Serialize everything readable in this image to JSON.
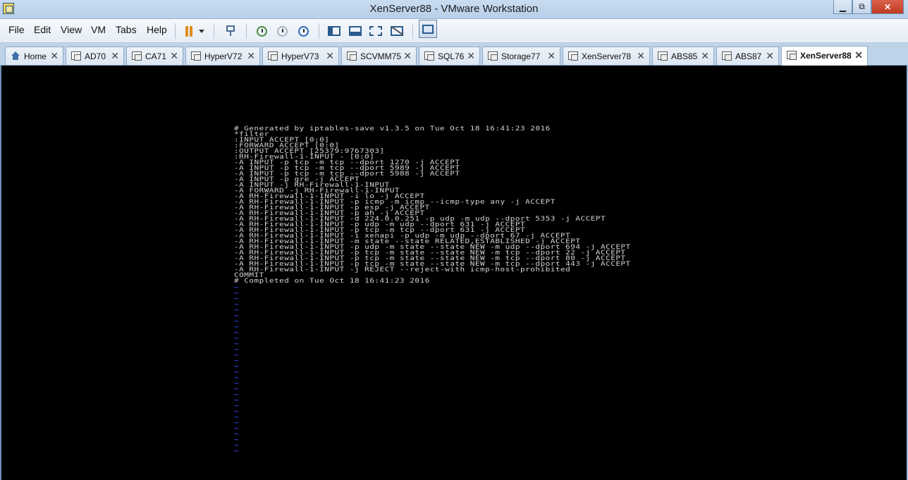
{
  "window": {
    "title": "XenServer88 - VMware Workstation",
    "controls": {
      "minimize": "▁",
      "maximize": "⧉",
      "close": "✕"
    }
  },
  "menu": {
    "items": [
      "File",
      "Edit",
      "View",
      "VM",
      "Tabs",
      "Help"
    ]
  },
  "toolbar": {
    "icons": [
      "pause-icon",
      "dropdown-arrow-icon",
      "send-keys-icon",
      "snapshot-icon",
      "revert-snapshot-icon",
      "snapshot-manager-icon",
      "show-library-icon",
      "thumbnail-bar-icon",
      "full-screen-icon",
      "unity-icon",
      "console-view-icon"
    ]
  },
  "tabs": [
    {
      "label": "Home",
      "icon": "home-icon",
      "active": false
    },
    {
      "label": "AD70",
      "icon": "vm-icon",
      "active": false
    },
    {
      "label": "CA71",
      "icon": "vm-icon",
      "active": false
    },
    {
      "label": "HyperV72",
      "icon": "vm-icon",
      "active": false
    },
    {
      "label": "HyperV73",
      "icon": "vm-icon",
      "active": false
    },
    {
      "label": "SCVMM75",
      "icon": "vm-icon",
      "active": false
    },
    {
      "label": "SQL76",
      "icon": "vm-icon",
      "active": false
    },
    {
      "label": "Storage77",
      "icon": "vm-icon",
      "active": false
    },
    {
      "label": "XenServer78",
      "icon": "vm-icon",
      "active": false
    },
    {
      "label": "ABS85",
      "icon": "vm-icon",
      "active": false
    },
    {
      "label": "ABS87",
      "icon": "vm-icon",
      "active": false
    },
    {
      "label": "XenServer88",
      "icon": "vm-icon",
      "active": true
    }
  ],
  "tab_close_glyph": "✕",
  "console": {
    "lines": [
      "# Generated by iptables-save v1.3.5 on Tue Oct 18 16:41:23 2016",
      "*filter",
      ":INPUT ACCEPT [0:0]",
      ":FORWARD ACCEPT [0:0]",
      ":OUTPUT ACCEPT [25379:9767303]",
      ":RH-Firewall-1-INPUT - [0:0]",
      "-A INPUT -p tcp -m tcp --dport 1270 -j ACCEPT",
      "-A INPUT -p tcp -m tcp --dport 5989 -j ACCEPT",
      "-A INPUT -p tcp -m tcp --dport 5988 -j ACCEPT",
      "-A INPUT -p gre -j ACCEPT",
      "-A INPUT -j RH-Firewall-1-INPUT",
      "-A FORWARD -j RH-Firewall-1-INPUT",
      "-A RH-Firewall-1-INPUT -i lo -j ACCEPT",
      "-A RH-Firewall-1-INPUT -p icmp -m icmp --icmp-type any -j ACCEPT",
      "-A RH-Firewall-1-INPUT -p esp -j ACCEPT",
      "-A RH-Firewall-1-INPUT -p ah -j ACCEPT",
      "-A RH-Firewall-1-INPUT -d 224.0.0.251 -p udp -m udp --dport 5353 -j ACCEPT",
      "-A RH-Firewall-1-INPUT -p udp -m udp --dport 631 -j ACCEPT",
      "-A RH-Firewall-1-INPUT -p tcp -m tcp --dport 631 -j ACCEPT",
      "-A RH-Firewall-1-INPUT -i xenapi -p udp -m udp --dport 67 -j ACCEPT",
      "-A RH-Firewall-1-INPUT -m state --state RELATED,ESTABLISHED -j ACCEPT",
      "-A RH-Firewall-1-INPUT -p udp -m state --state NEW -m udp --dport 694 -j ACCEPT",
      "-A RH-Firewall-1-INPUT -p tcp -m state --state NEW -m tcp --dport 22 -j ACCEPT",
      "-A RH-Firewall-1-INPUT -p tcp -m state --state NEW -m tcp --dport 80 -j ACCEPT",
      "-A RH-Firewall-1-INPUT -p tcp -m state --state NEW -m tcp --dport 443 -j ACCEPT",
      "-A RH-Firewall-1-INPUT -j REJECT --reject-with icmp-host-prohibited",
      "COMMIT",
      "# Completed on Tue Oct 18 16:41:23 2016"
    ],
    "tilde_char": "~",
    "tilde_count": 30,
    "colors": {
      "background": "#000000",
      "text": "#d6d6d6",
      "tilde": "#3a4bff"
    }
  }
}
